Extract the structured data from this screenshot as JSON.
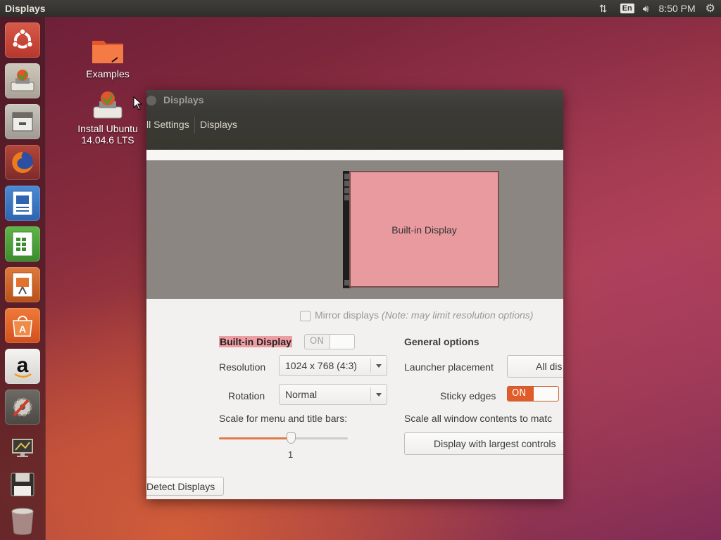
{
  "top_panel": {
    "app_title": "Displays",
    "keyboard_layout": "En",
    "clock": "8:50 PM",
    "icons": [
      "network-arrows-icon",
      "keyboard-layout-indicator",
      "volume-icon",
      "system-gear-icon"
    ]
  },
  "launcher": {
    "items": [
      {
        "name": "ubuntu-dash",
        "icon": "ubuntu-logo-icon"
      },
      {
        "name": "install-ubuntu",
        "icon": "installer-icon"
      },
      {
        "name": "files",
        "icon": "file-cabinet-icon"
      },
      {
        "name": "firefox",
        "icon": "firefox-icon"
      },
      {
        "name": "libreoffice-writer",
        "icon": "writer-icon"
      },
      {
        "name": "libreoffice-calc",
        "icon": "calc-icon"
      },
      {
        "name": "libreoffice-impress",
        "icon": "impress-icon"
      },
      {
        "name": "ubuntu-software",
        "icon": "software-center-icon"
      },
      {
        "name": "amazon",
        "icon": "amazon-icon"
      },
      {
        "name": "system-settings",
        "icon": "settings-tools-icon"
      },
      {
        "name": "displays",
        "icon": "display-settings-icon"
      },
      {
        "name": "save-drive",
        "icon": "floppy-icon"
      },
      {
        "name": "trash",
        "icon": "trash-icon"
      }
    ]
  },
  "desktop": {
    "icons": [
      {
        "label": "Examples"
      },
      {
        "label_line1": "Install Ubuntu",
        "label_line2": "14.04.6 LTS"
      }
    ]
  },
  "window": {
    "title": "Displays",
    "breadcrumb": {
      "all_settings": "ll Settings",
      "current": "Displays"
    },
    "monitor_label": "Built-in Display",
    "mirror": {
      "label": "Mirror displays",
      "note": "(Note: may limit resolution options)",
      "checked": false
    },
    "display_name": "Built-in Display",
    "display_switch": "ON",
    "resolution": {
      "label": "Resolution",
      "value": "1024 x 768 (4:3)"
    },
    "rotation": {
      "label": "Rotation",
      "value": "Normal"
    },
    "scale": {
      "label": "Scale for menu and title bars:",
      "value": "1",
      "position": 0.56
    },
    "general": {
      "heading": "General options",
      "launcher_placement_label": "Launcher placement",
      "launcher_placement_value": "All dis",
      "sticky_edges_label": "Sticky edges",
      "sticky_edges_value": "ON",
      "scale_all_label": "Scale all window contents to matc",
      "scale_all_button": "Display with largest controls"
    },
    "detect_button": "Detect Displays"
  },
  "colors": {
    "accent": "#e05c2a",
    "monitor_fill": "#e99a9e",
    "panel_bg": "#3b3a36"
  }
}
